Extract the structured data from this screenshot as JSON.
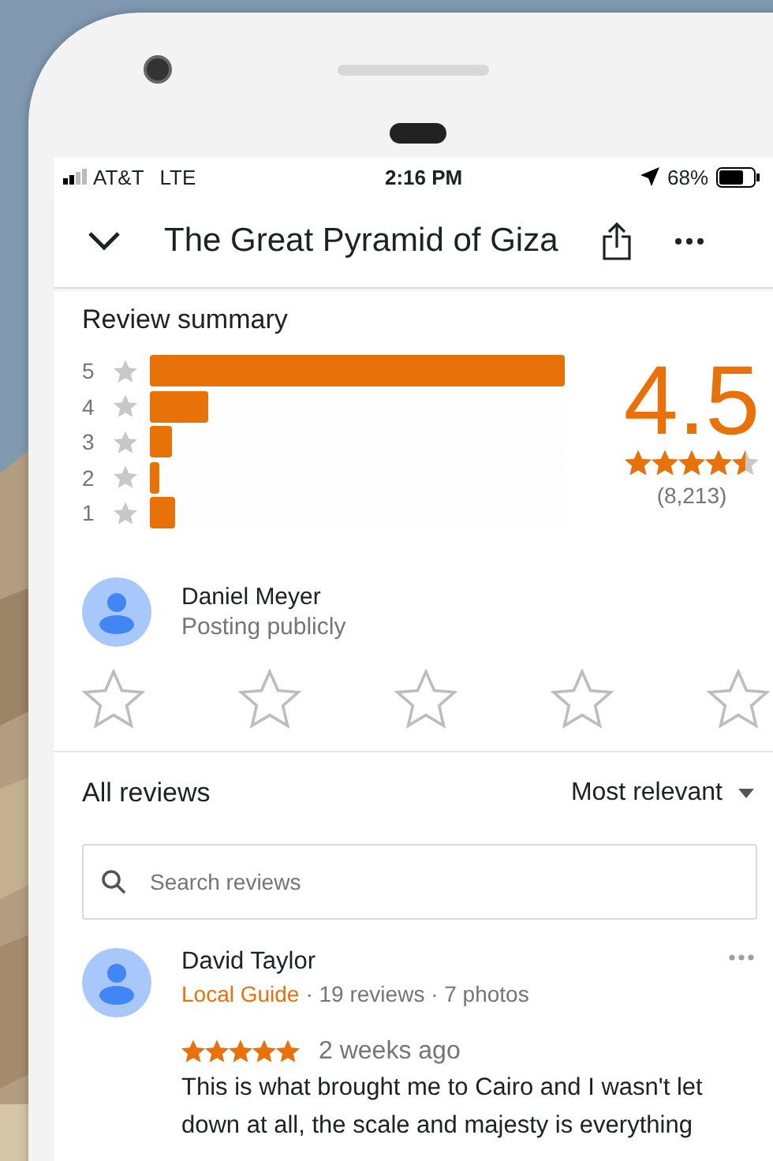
{
  "status_bar": {
    "carrier": "AT&T",
    "network": "LTE",
    "time": "2:16 PM",
    "battery": "68%"
  },
  "header": {
    "title": "The Great Pyramid of Giza"
  },
  "summary": {
    "title": "Review summary",
    "rating": "4.5",
    "stars": 4.5,
    "count": "(8,213)",
    "bars": [
      {
        "label": "5",
        "level": 1
      },
      {
        "label": "4",
        "level": 0.14
      },
      {
        "label": "3",
        "level": 0.055
      },
      {
        "label": "2",
        "level": 0.022
      },
      {
        "label": "1",
        "level": 0.062
      }
    ]
  },
  "compose": {
    "name": "Daniel Meyer",
    "subtitle": "Posting publicly",
    "stars": 0
  },
  "reviews": {
    "title": "All reviews",
    "sort": "Most relevant",
    "search": {
      "placeholder": "Search reviews"
    },
    "items": [
      {
        "author": "David Taylor",
        "badge": "Local Guide",
        "meta": "· 19 reviews · 7 photos",
        "stars": 5,
        "time": "2 weeks ago",
        "text": "This is what brought me to Cairo and I wasn't let down at all, the scale and majesty is everything"
      }
    ]
  }
}
